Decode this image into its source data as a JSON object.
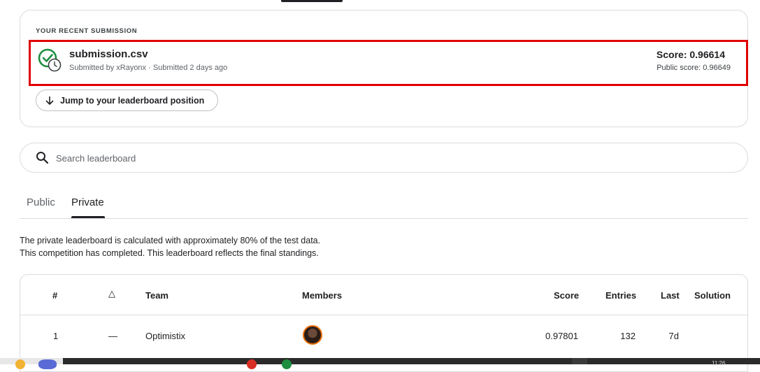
{
  "recent_submission": {
    "section_label": "YOUR RECENT SUBMISSION",
    "filename": "submission.csv",
    "meta": "Submitted by xRayonx · Submitted 2 days ago",
    "score": "Score: 0.96614",
    "public_score": "Public score: 0.96649",
    "status_icon": "check-circle-clock-icon",
    "jump_button_label": "Jump to your leaderboard position"
  },
  "search": {
    "placeholder": "Search leaderboard"
  },
  "tabs": [
    {
      "label": "Public",
      "active": false
    },
    {
      "label": "Private",
      "active": true
    }
  ],
  "info": {
    "line1": "The private leaderboard is calculated with approximately 80% of the test data.",
    "line2": "This competition has completed. This leaderboard reflects the final standings."
  },
  "table": {
    "headers": {
      "rank": "#",
      "delta": "△",
      "team": "Team",
      "members": "Members",
      "score": "Score",
      "entries": "Entries",
      "last": "Last",
      "solution": "Solution"
    },
    "rows": [
      {
        "rank": "1",
        "delta": "—",
        "team": "Optimistix",
        "score": "0.97801",
        "entries": "132",
        "last": "7d"
      }
    ]
  },
  "taskbar": {
    "clock": "11:26"
  },
  "colors": {
    "highlight_border": "#e00000",
    "success_green": "#1e8e3e",
    "avatar_ring": "#e8710a"
  }
}
